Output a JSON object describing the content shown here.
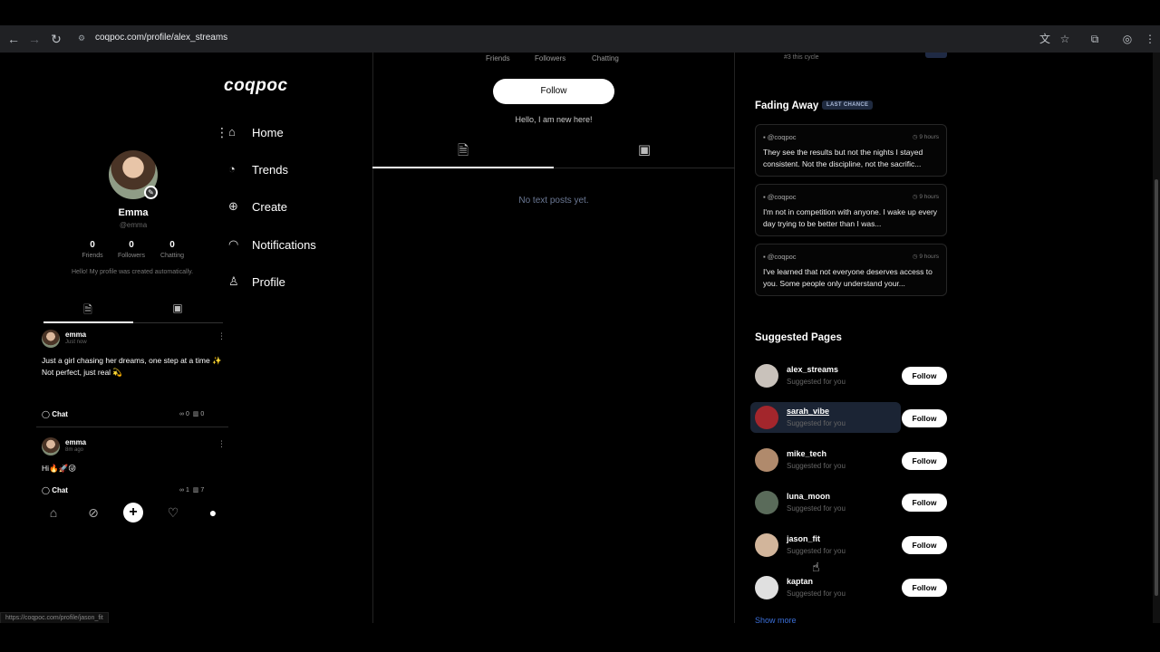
{
  "browser": {
    "url": "coqpoc.com/profile/alex_streams",
    "status_url": "https://coqpoc.com/profile/jason_fit"
  },
  "app": {
    "logo": "coqpoc"
  },
  "side_nav": {
    "items": [
      {
        "label": "Home",
        "icon": "home-icon"
      },
      {
        "label": "Trends",
        "icon": "trends-icon"
      },
      {
        "label": "Create",
        "icon": "create-icon"
      },
      {
        "label": "Notifications",
        "icon": "bell-icon"
      },
      {
        "label": "Profile",
        "icon": "profile-icon"
      }
    ]
  },
  "mobile_profile": {
    "name": "Emma",
    "handle": "@emma",
    "stats": [
      {
        "value": "0",
        "label": "Friends"
      },
      {
        "value": "0",
        "label": "Followers"
      },
      {
        "value": "0",
        "label": "Chatting"
      }
    ],
    "bio": "Hello! My profile was created automatically.",
    "posts": [
      {
        "author": "emma",
        "time": "Just now",
        "text_line1": "Just a girl chasing her dreams, one step at a time ✨",
        "text_line2": "Not perfect, just real 💫",
        "chat_label": "Chat",
        "loops": "0",
        "views": "0"
      },
      {
        "author": "emma",
        "time": "8m ago",
        "text_line1": "Hi🔥🚀😜",
        "chat_label": "Chat",
        "loops": "1",
        "views": "7"
      }
    ]
  },
  "center": {
    "stats_labels": [
      "Friends",
      "Followers",
      "Chatting"
    ],
    "follow_label": "Follow",
    "bio": "Hello, I am new here!",
    "empty_text": "No text posts yet."
  },
  "right": {
    "top_sub": "#3 this cycle",
    "fading_title": "Fading Away",
    "fading_chip": "LAST CHANCE",
    "cards": [
      {
        "author": "@coqpoc",
        "time": "9 hours",
        "text": "They see the results but not the nights I stayed consistent. Not the discipline, not the sacrific..."
      },
      {
        "author": "@coqpoc",
        "time": "9 hours",
        "text": "I'm not in competition with anyone. I wake up every day trying to be better than I was..."
      },
      {
        "author": "@coqpoc",
        "time": "9 hours",
        "text": "I've learned that not everyone deserves access to you. Some people only understand your..."
      }
    ],
    "suggested_title": "Suggested Pages",
    "suggested": [
      {
        "name": "alex_streams",
        "sub": "Suggested for you",
        "button": "Follow",
        "color": "#c9c2bb"
      },
      {
        "name": "sarah_vibe",
        "sub": "Suggested for you",
        "button": "Follow",
        "color": "#a3262c"
      },
      {
        "name": "mike_tech",
        "sub": "Suggested for you",
        "button": "Follow",
        "color": "#b08a6c"
      },
      {
        "name": "luna_moon",
        "sub": "Suggested for you",
        "button": "Follow",
        "color": "#5a6b5a"
      },
      {
        "name": "jason_fit",
        "sub": "Suggested for you",
        "button": "Follow",
        "color": "#d2b59b"
      },
      {
        "name": "kaptan",
        "sub": "Suggested for you",
        "button": "Follow",
        "color": "#e0e0e0"
      }
    ],
    "show_more": "Show more"
  }
}
